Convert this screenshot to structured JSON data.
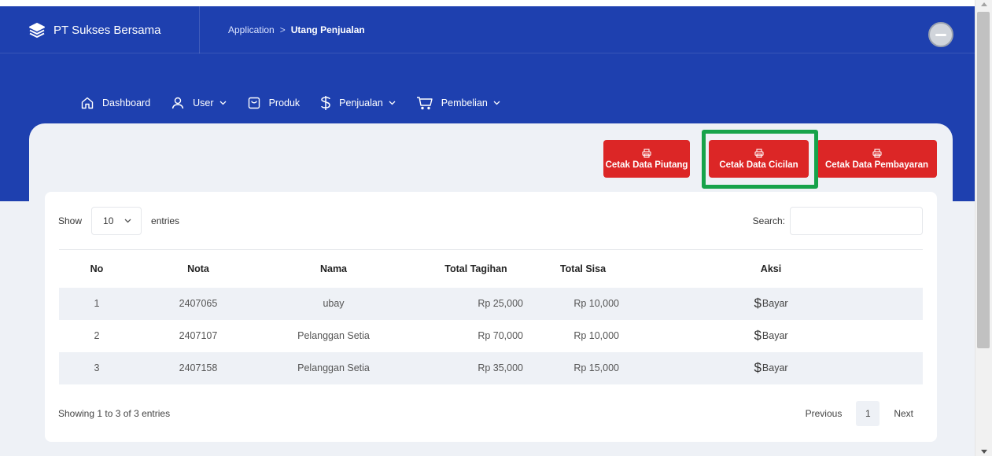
{
  "header": {
    "brand": "PT Sukses Bersama",
    "breadcrumb": {
      "parent": "Application",
      "separator": ">",
      "current": "Utang Penjualan"
    }
  },
  "nav": {
    "items": [
      {
        "label": "Dashboard",
        "icon": "home-icon"
      },
      {
        "label": "User",
        "icon": "user-icon",
        "dropdown": true
      },
      {
        "label": "Produk",
        "icon": "bag-icon"
      },
      {
        "label": "Penjualan",
        "icon": "dollar-icon",
        "dropdown": true
      },
      {
        "label": "Pembelian",
        "icon": "cart-icon",
        "dropdown": true
      }
    ]
  },
  "actions": {
    "print_piutang": "Cetak Data Piutang",
    "print_cicilan": "Cetak Data Cicilan",
    "print_pembayaran": "Cetak Data Pembayaran"
  },
  "table_controls": {
    "show_label": "Show",
    "entries_value": "10",
    "entries_label": "entries",
    "search_label": "Search:",
    "search_value": ""
  },
  "table": {
    "headers": {
      "no": "No",
      "nota": "Nota",
      "nama": "Nama",
      "total_tagihan": "Total Tagihan",
      "total_sisa": "Total Sisa",
      "aksi": "Aksi"
    },
    "rows": [
      {
        "no": "1",
        "nota": "2407065",
        "nama": "ubay",
        "total_tagihan": "Rp 25,000",
        "total_sisa": "Rp 10,000",
        "aksi": "Bayar"
      },
      {
        "no": "2",
        "nota": "2407107",
        "nama": "Pelanggan Setia",
        "total_tagihan": "Rp 70,000",
        "total_sisa": "Rp 10,000",
        "aksi": "Bayar"
      },
      {
        "no": "3",
        "nota": "2407158",
        "nama": "Pelanggan Setia",
        "total_tagihan": "Rp 35,000",
        "total_sisa": "Rp 15,000",
        "aksi": "Bayar"
      }
    ]
  },
  "footer": {
    "info": "Showing 1 to 3 of 3 entries",
    "previous": "Previous",
    "page": "1",
    "next": "Next"
  },
  "colors": {
    "primary": "#1e40af",
    "danger": "#dc2626",
    "highlight": "#16a34a"
  }
}
